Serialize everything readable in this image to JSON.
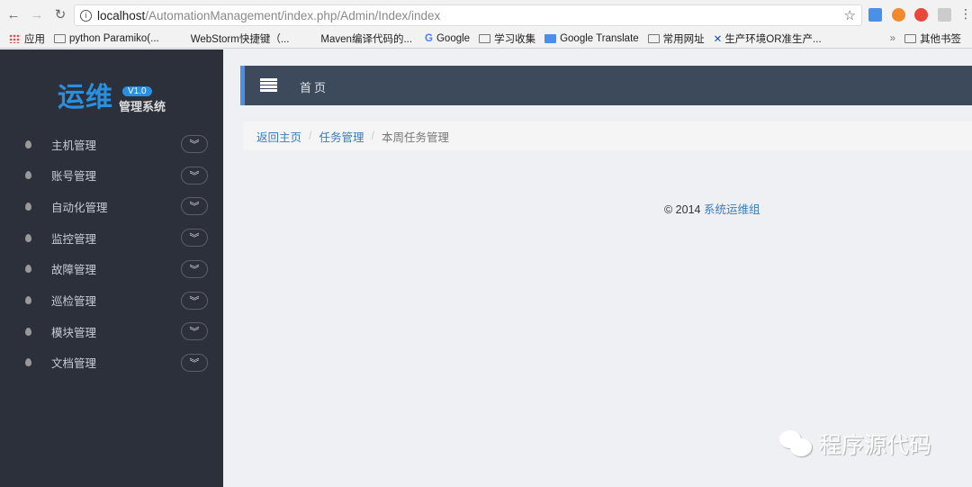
{
  "browser": {
    "url_host": "localhost",
    "url_path": "/AutomationManagement/index.php/Admin/Index/index",
    "bookmarks": [
      "应用",
      "python Paramiko(...",
      "WebStorm快捷键（...",
      "Maven编译代码的...",
      "Google",
      "学习收集",
      "Google Translate",
      "常用网址",
      "生产环境OR准生产..."
    ],
    "overflow": "»",
    "other_bookmarks": "其他书签"
  },
  "logo": {
    "main": "运维",
    "version": "V1.0",
    "sub": "管理系统"
  },
  "sidebar": {
    "items": [
      {
        "label": "主机管理"
      },
      {
        "label": "账号管理"
      },
      {
        "label": "自动化管理"
      },
      {
        "label": "监控管理"
      },
      {
        "label": "故障管理"
      },
      {
        "label": "巡检管理"
      },
      {
        "label": "模块管理"
      },
      {
        "label": "文档管理"
      }
    ]
  },
  "header": {
    "home": "首页"
  },
  "breadcrumb": {
    "home": "返回主页",
    "section": "任务管理",
    "current": "本周任务管理"
  },
  "footer": {
    "copyright": "© 2014",
    "team": "系统运维组"
  },
  "watermark": "程序源代码",
  "colors": {
    "sidebar": "#2b303b",
    "header": "#3d4a5c",
    "accent": "#4a90e2",
    "link": "#3a7bc0"
  }
}
